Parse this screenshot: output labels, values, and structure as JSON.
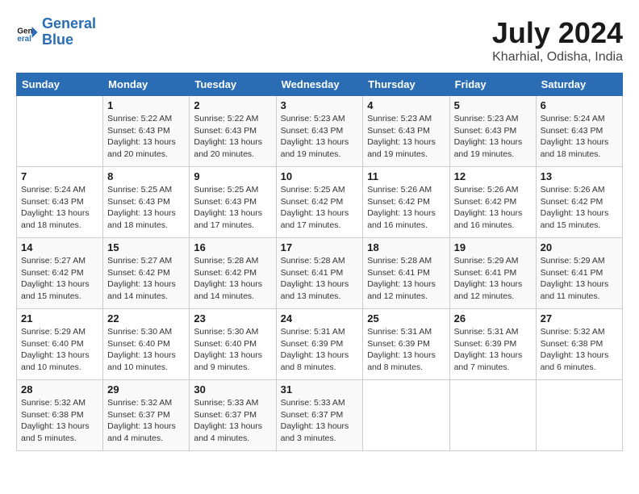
{
  "logo": {
    "name1": "General",
    "name2": "Blue"
  },
  "title": "July 2024",
  "location": "Kharhial, Odisha, India",
  "headers": [
    "Sunday",
    "Monday",
    "Tuesday",
    "Wednesday",
    "Thursday",
    "Friday",
    "Saturday"
  ],
  "weeks": [
    [
      {
        "day": "",
        "info": ""
      },
      {
        "day": "1",
        "info": "Sunrise: 5:22 AM\nSunset: 6:43 PM\nDaylight: 13 hours\nand 20 minutes."
      },
      {
        "day": "2",
        "info": "Sunrise: 5:22 AM\nSunset: 6:43 PM\nDaylight: 13 hours\nand 20 minutes."
      },
      {
        "day": "3",
        "info": "Sunrise: 5:23 AM\nSunset: 6:43 PM\nDaylight: 13 hours\nand 19 minutes."
      },
      {
        "day": "4",
        "info": "Sunrise: 5:23 AM\nSunset: 6:43 PM\nDaylight: 13 hours\nand 19 minutes."
      },
      {
        "day": "5",
        "info": "Sunrise: 5:23 AM\nSunset: 6:43 PM\nDaylight: 13 hours\nand 19 minutes."
      },
      {
        "day": "6",
        "info": "Sunrise: 5:24 AM\nSunset: 6:43 PM\nDaylight: 13 hours\nand 18 minutes."
      }
    ],
    [
      {
        "day": "7",
        "info": "Sunrise: 5:24 AM\nSunset: 6:43 PM\nDaylight: 13 hours\nand 18 minutes."
      },
      {
        "day": "8",
        "info": "Sunrise: 5:25 AM\nSunset: 6:43 PM\nDaylight: 13 hours\nand 18 minutes."
      },
      {
        "day": "9",
        "info": "Sunrise: 5:25 AM\nSunset: 6:43 PM\nDaylight: 13 hours\nand 17 minutes."
      },
      {
        "day": "10",
        "info": "Sunrise: 5:25 AM\nSunset: 6:42 PM\nDaylight: 13 hours\nand 17 minutes."
      },
      {
        "day": "11",
        "info": "Sunrise: 5:26 AM\nSunset: 6:42 PM\nDaylight: 13 hours\nand 16 minutes."
      },
      {
        "day": "12",
        "info": "Sunrise: 5:26 AM\nSunset: 6:42 PM\nDaylight: 13 hours\nand 16 minutes."
      },
      {
        "day": "13",
        "info": "Sunrise: 5:26 AM\nSunset: 6:42 PM\nDaylight: 13 hours\nand 15 minutes."
      }
    ],
    [
      {
        "day": "14",
        "info": "Sunrise: 5:27 AM\nSunset: 6:42 PM\nDaylight: 13 hours\nand 15 minutes."
      },
      {
        "day": "15",
        "info": "Sunrise: 5:27 AM\nSunset: 6:42 PM\nDaylight: 13 hours\nand 14 minutes."
      },
      {
        "day": "16",
        "info": "Sunrise: 5:28 AM\nSunset: 6:42 PM\nDaylight: 13 hours\nand 14 minutes."
      },
      {
        "day": "17",
        "info": "Sunrise: 5:28 AM\nSunset: 6:41 PM\nDaylight: 13 hours\nand 13 minutes."
      },
      {
        "day": "18",
        "info": "Sunrise: 5:28 AM\nSunset: 6:41 PM\nDaylight: 13 hours\nand 12 minutes."
      },
      {
        "day": "19",
        "info": "Sunrise: 5:29 AM\nSunset: 6:41 PM\nDaylight: 13 hours\nand 12 minutes."
      },
      {
        "day": "20",
        "info": "Sunrise: 5:29 AM\nSunset: 6:41 PM\nDaylight: 13 hours\nand 11 minutes."
      }
    ],
    [
      {
        "day": "21",
        "info": "Sunrise: 5:29 AM\nSunset: 6:40 PM\nDaylight: 13 hours\nand 10 minutes."
      },
      {
        "day": "22",
        "info": "Sunrise: 5:30 AM\nSunset: 6:40 PM\nDaylight: 13 hours\nand 10 minutes."
      },
      {
        "day": "23",
        "info": "Sunrise: 5:30 AM\nSunset: 6:40 PM\nDaylight: 13 hours\nand 9 minutes."
      },
      {
        "day": "24",
        "info": "Sunrise: 5:31 AM\nSunset: 6:39 PM\nDaylight: 13 hours\nand 8 minutes."
      },
      {
        "day": "25",
        "info": "Sunrise: 5:31 AM\nSunset: 6:39 PM\nDaylight: 13 hours\nand 8 minutes."
      },
      {
        "day": "26",
        "info": "Sunrise: 5:31 AM\nSunset: 6:39 PM\nDaylight: 13 hours\nand 7 minutes."
      },
      {
        "day": "27",
        "info": "Sunrise: 5:32 AM\nSunset: 6:38 PM\nDaylight: 13 hours\nand 6 minutes."
      }
    ],
    [
      {
        "day": "28",
        "info": "Sunrise: 5:32 AM\nSunset: 6:38 PM\nDaylight: 13 hours\nand 5 minutes."
      },
      {
        "day": "29",
        "info": "Sunrise: 5:32 AM\nSunset: 6:37 PM\nDaylight: 13 hours\nand 4 minutes."
      },
      {
        "day": "30",
        "info": "Sunrise: 5:33 AM\nSunset: 6:37 PM\nDaylight: 13 hours\nand 4 minutes."
      },
      {
        "day": "31",
        "info": "Sunrise: 5:33 AM\nSunset: 6:37 PM\nDaylight: 13 hours\nand 3 minutes."
      },
      {
        "day": "",
        "info": ""
      },
      {
        "day": "",
        "info": ""
      },
      {
        "day": "",
        "info": ""
      }
    ]
  ]
}
